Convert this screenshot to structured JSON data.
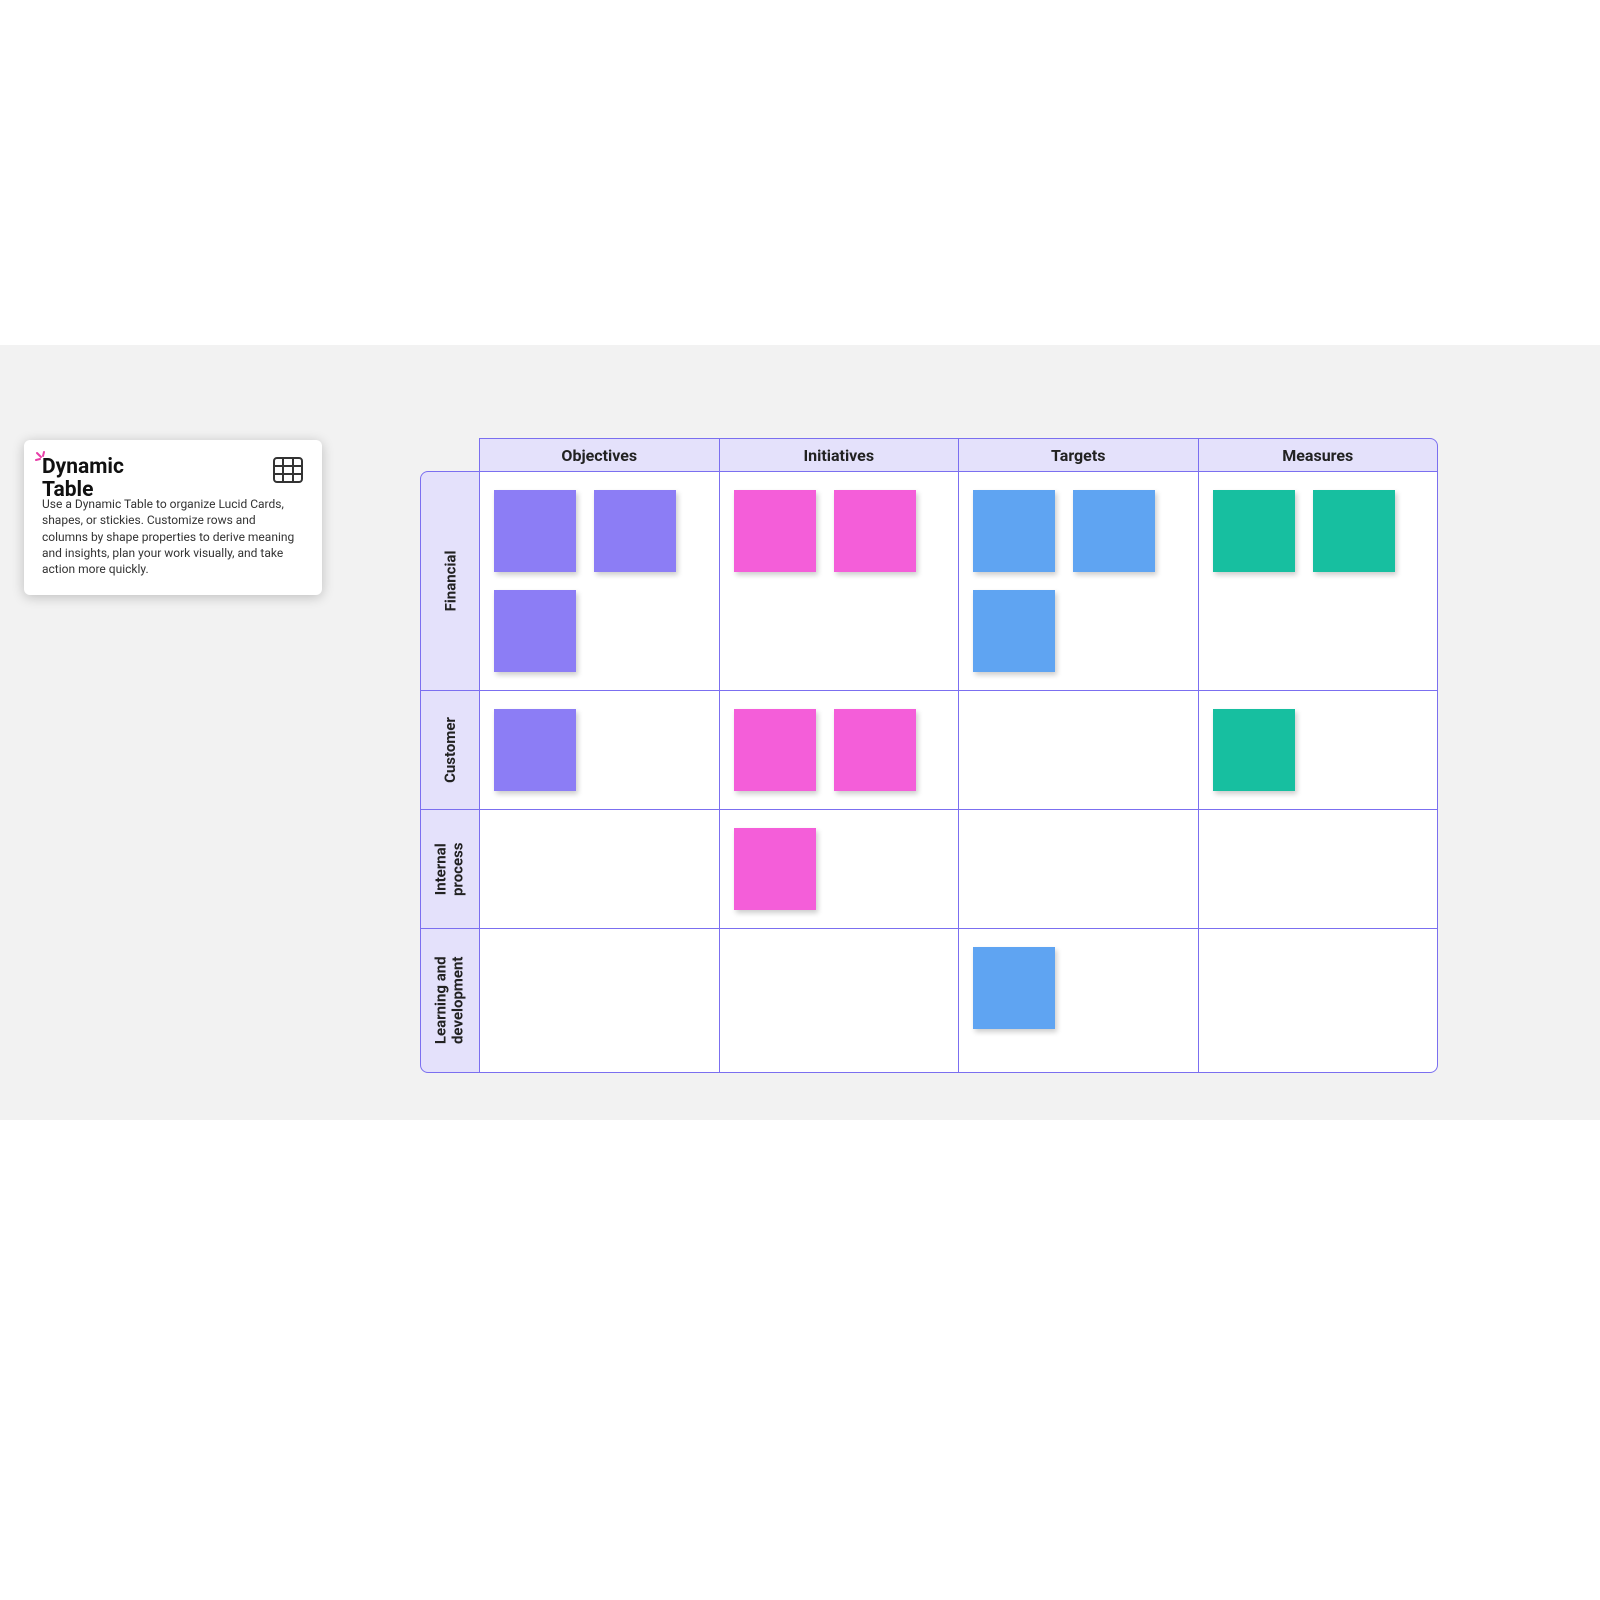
{
  "info": {
    "title": "Dynamic Table",
    "description": "Use a Dynamic Table to organize Lucid Cards, shapes, or stickies. Customize rows and columns by shape properties to derive meaning and insights, plan your work visually, and take action more quickly."
  },
  "table": {
    "columns": [
      "Objectives",
      "Initiatives",
      "Targets",
      "Measures"
    ],
    "rows": [
      {
        "label": "Financial",
        "heightClass": "row-financial"
      },
      {
        "label": "Customer",
        "heightClass": "row-customer"
      },
      {
        "label": "Internal process",
        "heightClass": "row-internal"
      },
      {
        "label": "Learning and development",
        "heightClass": "row-learning"
      }
    ],
    "colors": {
      "purple": "#8c7df5",
      "pink": "#f45ed9",
      "blue": "#5fa4f2",
      "teal": "#17bfa0",
      "headerFill": "#e4e1fb",
      "border": "#7b6ff0"
    },
    "cells": [
      [
        {
          "stickies": [
            "purple",
            "purple",
            "purple"
          ]
        },
        {
          "stickies": [
            "pink",
            "pink"
          ]
        },
        {
          "stickies": [
            "blue",
            "blue",
            "blue"
          ]
        },
        {
          "stickies": [
            "teal",
            "teal"
          ]
        }
      ],
      [
        {
          "stickies": [
            "purple"
          ]
        },
        {
          "stickies": [
            "pink",
            "pink"
          ]
        },
        {
          "stickies": []
        },
        {
          "stickies": [
            "teal"
          ]
        }
      ],
      [
        {
          "stickies": []
        },
        {
          "stickies": [
            "pink"
          ]
        },
        {
          "stickies": []
        },
        {
          "stickies": []
        }
      ],
      [
        {
          "stickies": []
        },
        {
          "stickies": []
        },
        {
          "stickies": [
            "blue"
          ]
        },
        {
          "stickies": []
        }
      ]
    ]
  }
}
